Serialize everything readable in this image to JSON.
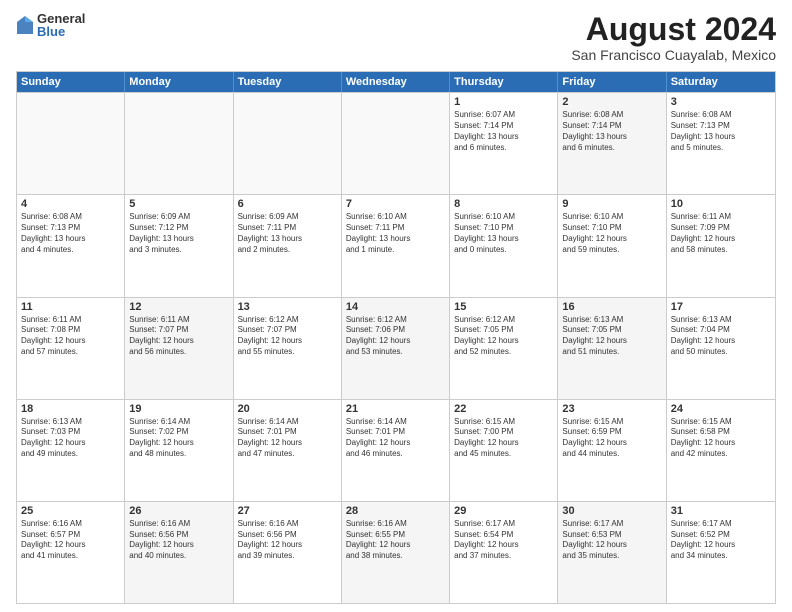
{
  "logo": {
    "general": "General",
    "blue": "Blue"
  },
  "title": "August 2024",
  "subtitle": "San Francisco Cuayalab, Mexico",
  "header_days": [
    "Sunday",
    "Monday",
    "Tuesday",
    "Wednesday",
    "Thursday",
    "Friday",
    "Saturday"
  ],
  "weeks": [
    [
      {
        "day": "",
        "info": "",
        "empty": true
      },
      {
        "day": "",
        "info": "",
        "empty": true
      },
      {
        "day": "",
        "info": "",
        "empty": true
      },
      {
        "day": "",
        "info": "",
        "empty": true
      },
      {
        "day": "1",
        "info": "Sunrise: 6:07 AM\nSunset: 7:14 PM\nDaylight: 13 hours\nand 6 minutes.",
        "empty": false
      },
      {
        "day": "2",
        "info": "Sunrise: 6:08 AM\nSunset: 7:14 PM\nDaylight: 13 hours\nand 6 minutes.",
        "empty": false
      },
      {
        "day": "3",
        "info": "Sunrise: 6:08 AM\nSunset: 7:13 PM\nDaylight: 13 hours\nand 5 minutes.",
        "empty": false
      }
    ],
    [
      {
        "day": "4",
        "info": "Sunrise: 6:08 AM\nSunset: 7:13 PM\nDaylight: 13 hours\nand 4 minutes.",
        "empty": false
      },
      {
        "day": "5",
        "info": "Sunrise: 6:09 AM\nSunset: 7:12 PM\nDaylight: 13 hours\nand 3 minutes.",
        "empty": false
      },
      {
        "day": "6",
        "info": "Sunrise: 6:09 AM\nSunset: 7:11 PM\nDaylight: 13 hours\nand 2 minutes.",
        "empty": false
      },
      {
        "day": "7",
        "info": "Sunrise: 6:10 AM\nSunset: 7:11 PM\nDaylight: 13 hours\nand 1 minute.",
        "empty": false
      },
      {
        "day": "8",
        "info": "Sunrise: 6:10 AM\nSunset: 7:10 PM\nDaylight: 13 hours\nand 0 minutes.",
        "empty": false
      },
      {
        "day": "9",
        "info": "Sunrise: 6:10 AM\nSunset: 7:10 PM\nDaylight: 12 hours\nand 59 minutes.",
        "empty": false
      },
      {
        "day": "10",
        "info": "Sunrise: 6:11 AM\nSunset: 7:09 PM\nDaylight: 12 hours\nand 58 minutes.",
        "empty": false
      }
    ],
    [
      {
        "day": "11",
        "info": "Sunrise: 6:11 AM\nSunset: 7:08 PM\nDaylight: 12 hours\nand 57 minutes.",
        "empty": false
      },
      {
        "day": "12",
        "info": "Sunrise: 6:11 AM\nSunset: 7:07 PM\nDaylight: 12 hours\nand 56 minutes.",
        "empty": false
      },
      {
        "day": "13",
        "info": "Sunrise: 6:12 AM\nSunset: 7:07 PM\nDaylight: 12 hours\nand 55 minutes.",
        "empty": false
      },
      {
        "day": "14",
        "info": "Sunrise: 6:12 AM\nSunset: 7:06 PM\nDaylight: 12 hours\nand 53 minutes.",
        "empty": false
      },
      {
        "day": "15",
        "info": "Sunrise: 6:12 AM\nSunset: 7:05 PM\nDaylight: 12 hours\nand 52 minutes.",
        "empty": false
      },
      {
        "day": "16",
        "info": "Sunrise: 6:13 AM\nSunset: 7:05 PM\nDaylight: 12 hours\nand 51 minutes.",
        "empty": false
      },
      {
        "day": "17",
        "info": "Sunrise: 6:13 AM\nSunset: 7:04 PM\nDaylight: 12 hours\nand 50 minutes.",
        "empty": false
      }
    ],
    [
      {
        "day": "18",
        "info": "Sunrise: 6:13 AM\nSunset: 7:03 PM\nDaylight: 12 hours\nand 49 minutes.",
        "empty": false
      },
      {
        "day": "19",
        "info": "Sunrise: 6:14 AM\nSunset: 7:02 PM\nDaylight: 12 hours\nand 48 minutes.",
        "empty": false
      },
      {
        "day": "20",
        "info": "Sunrise: 6:14 AM\nSunset: 7:01 PM\nDaylight: 12 hours\nand 47 minutes.",
        "empty": false
      },
      {
        "day": "21",
        "info": "Sunrise: 6:14 AM\nSunset: 7:01 PM\nDaylight: 12 hours\nand 46 minutes.",
        "empty": false
      },
      {
        "day": "22",
        "info": "Sunrise: 6:15 AM\nSunset: 7:00 PM\nDaylight: 12 hours\nand 45 minutes.",
        "empty": false
      },
      {
        "day": "23",
        "info": "Sunrise: 6:15 AM\nSunset: 6:59 PM\nDaylight: 12 hours\nand 44 minutes.",
        "empty": false
      },
      {
        "day": "24",
        "info": "Sunrise: 6:15 AM\nSunset: 6:58 PM\nDaylight: 12 hours\nand 42 minutes.",
        "empty": false
      }
    ],
    [
      {
        "day": "25",
        "info": "Sunrise: 6:16 AM\nSunset: 6:57 PM\nDaylight: 12 hours\nand 41 minutes.",
        "empty": false
      },
      {
        "day": "26",
        "info": "Sunrise: 6:16 AM\nSunset: 6:56 PM\nDaylight: 12 hours\nand 40 minutes.",
        "empty": false
      },
      {
        "day": "27",
        "info": "Sunrise: 6:16 AM\nSunset: 6:56 PM\nDaylight: 12 hours\nand 39 minutes.",
        "empty": false
      },
      {
        "day": "28",
        "info": "Sunrise: 6:16 AM\nSunset: 6:55 PM\nDaylight: 12 hours\nand 38 minutes.",
        "empty": false
      },
      {
        "day": "29",
        "info": "Sunrise: 6:17 AM\nSunset: 6:54 PM\nDaylight: 12 hours\nand 37 minutes.",
        "empty": false
      },
      {
        "day": "30",
        "info": "Sunrise: 6:17 AM\nSunset: 6:53 PM\nDaylight: 12 hours\nand 35 minutes.",
        "empty": false
      },
      {
        "day": "31",
        "info": "Sunrise: 6:17 AM\nSunset: 6:52 PM\nDaylight: 12 hours\nand 34 minutes.",
        "empty": false
      }
    ]
  ]
}
